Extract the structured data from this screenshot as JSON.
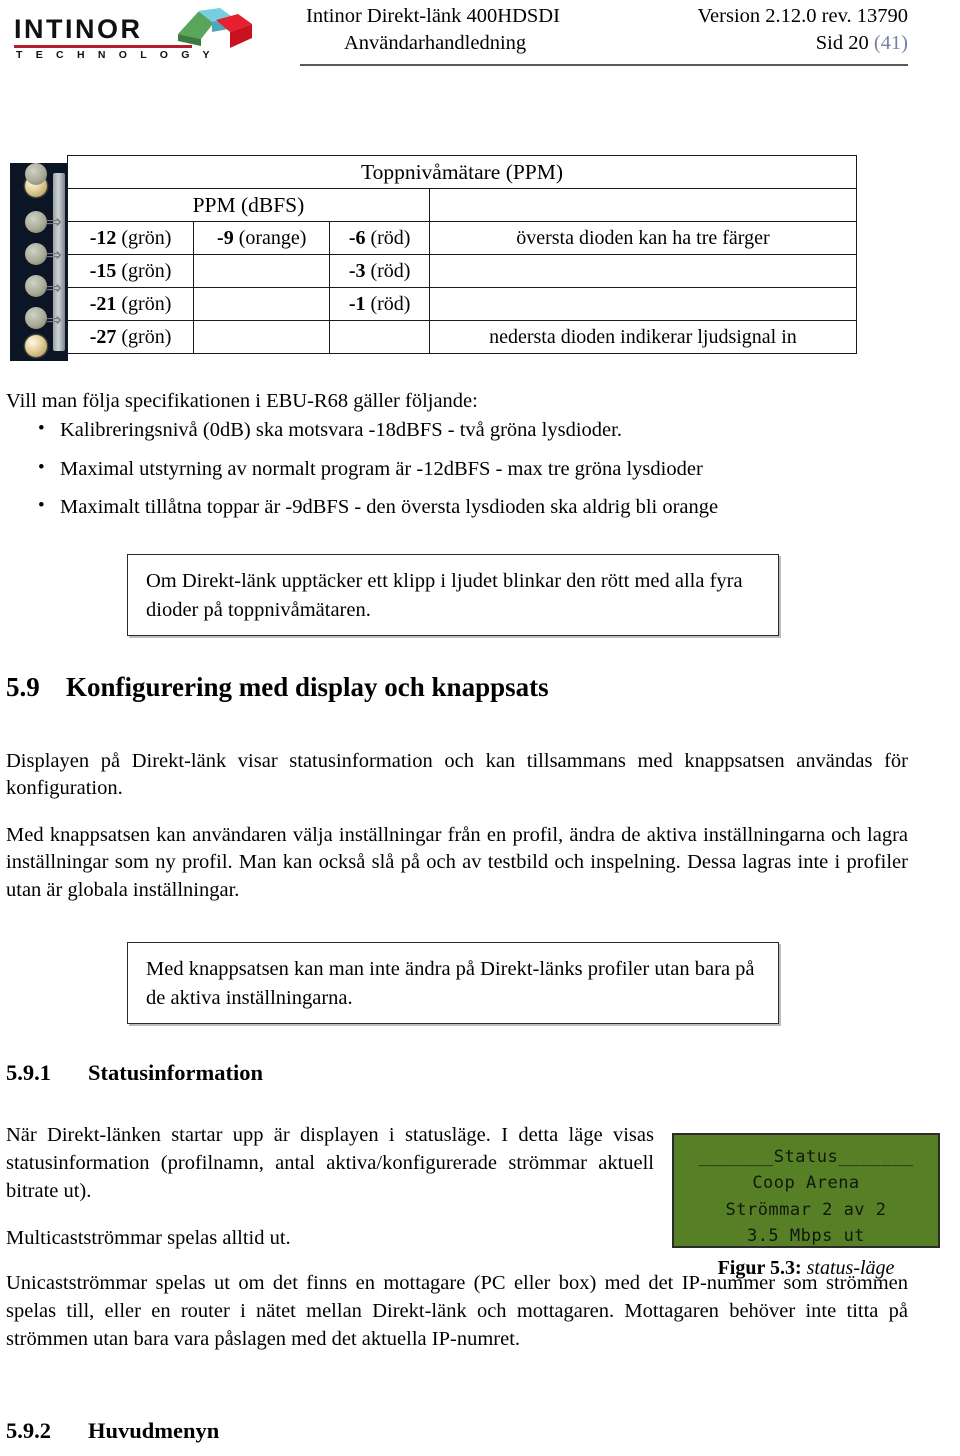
{
  "header": {
    "logo_word": "INTINOR",
    "logo_sub": "T E C H N O L O G Y",
    "title_line1": "Intinor Direkt-länk 400HDSDI",
    "title_line2": "Användarhandledning",
    "version": "Version 2.12.0 rev. 13790",
    "page_label": "Sid 20",
    "page_total": "(41)",
    "link_color": "#7681a8"
  },
  "ppm_table": {
    "title": "Toppnivåmätare (PPM)",
    "subheader": "PPM (dBFS)",
    "rows": [
      {
        "col1_num": "-12",
        "col1_color": "(grön)",
        "col2_num": "-9",
        "col2_color": "(orange)",
        "col3_num": "-6",
        "col3_color": "(röd)",
        "note": "översta dioden kan ha tre färger"
      },
      {
        "col1_num": "-15",
        "col1_color": "(grön)",
        "col2_num": "",
        "col2_color": "",
        "col3_num": "-3",
        "col3_color": "(röd)",
        "note": ""
      },
      {
        "col1_num": "-21",
        "col1_color": "(grön)",
        "col2_num": "",
        "col2_color": "",
        "col3_num": "-1",
        "col3_color": "(röd)",
        "note": ""
      },
      {
        "col1_num": "-27",
        "col1_color": "(grön)",
        "col2_num": "",
        "col2_color": "",
        "col3_num": "",
        "col3_color": "",
        "note": "nedersta dioden indikerar ljudsignal in"
      }
    ],
    "arrow_glyph": "⇒"
  },
  "content": {
    "intro": "Vill man följa specifikationen i EBU-R68 gäller följande:",
    "bullets": [
      "Kalibreringsnivå (0dB) ska motsvara -18dBFS - två gröna lysdioder.",
      "Maximal utstyrning av normalt program är -12dBFS - max tre gröna lysdioder",
      "Maximalt tillåtna toppar är -9dBFS - den översta lysdioden ska aldrig bli orange"
    ],
    "notebox_1": "Om Direkt-länk upptäcker ett klipp i ljudet blinkar den rött med alla fyra dioder på toppnivåmätaren.",
    "notebox_2": "Med knappsatsen kan man inte ändra på Direkt-länks profiler utan bara på de aktiva inställningarna.",
    "section_59_num": "5.9",
    "section_59_title": "Konfigurering med display och knappsats",
    "para_59_1": "Displayen på Direkt-länk visar statusinformation och kan tillsammans med knappsatsen användas för konfiguration.",
    "para_59_2": "Med knappsatsen kan användaren välja inställningar från en profil, ändra de aktiva inställningarna och lagra inställningar som ny profil. Man kan också slå på och av testbild och inspelning. Dessa lagras inte i profiler utan är globala inställningar.",
    "section_591_num": "5.9.1",
    "section_591_title": "Statusinformation",
    "para_591_1": "När Direkt-länken startar upp är displayen i statusläge. I detta läge visas statusinformation (profilnamn, antal aktiva/konfigurerade strömmar aktuell bitrate ut).",
    "para_591_2": "Multicastströmmar spelas alltid ut.",
    "para_591_3": "Unicastströmmar spelas ut om det finns en mottagare (PC eller box) med det IP-nummer som strömmen spelas till, eller en router i nätet mellan Direkt-länk och mottagaren. Mottagaren behöver inte titta på strömmen utan bara vara påslagen med det aktuella IP-numret.",
    "section_592_num": "5.9.2",
    "section_592_title": "Huvudmenyn"
  },
  "figure": {
    "lcd_background": "#578026",
    "lcd_line1": "_______Status_______",
    "lcd_line2": "Coop Arena",
    "lcd_line3": "Strömmar 2 av 2",
    "lcd_line4": "3.5 Mbps ut",
    "caption_label": "Figur 5.3:",
    "caption_text": "status-läge"
  }
}
